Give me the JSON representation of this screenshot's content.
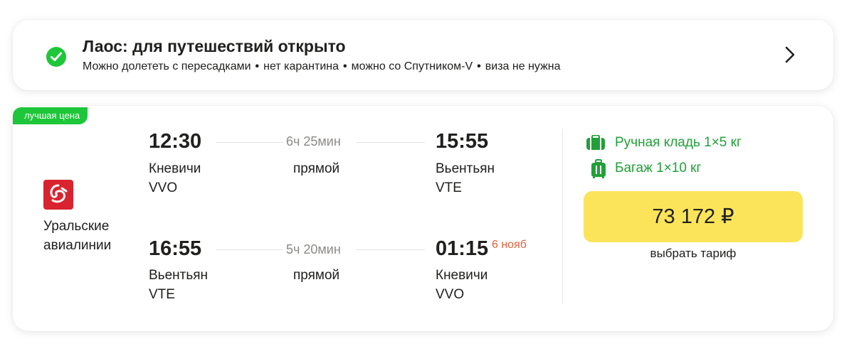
{
  "info": {
    "title": "Лаос: для путешествий открыто",
    "tags": [
      "Можно долететь с пересадками",
      "нет карантина",
      "можно со Спутником-V",
      "виза не нужна"
    ],
    "separator": "•"
  },
  "flight": {
    "badge": "лучшая цена",
    "airline": "Уральские авиалинии",
    "outbound": {
      "departure_time": "12:30",
      "departure_city": "Кневичи",
      "departure_code": "VVO",
      "duration": "6ч 25мин",
      "type": "прямой",
      "arrival_time": "15:55",
      "arrival_city": "Вьентьян",
      "arrival_code": "VTE"
    },
    "return": {
      "departure_time": "16:55",
      "departure_city": "Вьентьян",
      "departure_code": "VTE",
      "duration": "5ч 20мин",
      "type": "прямой",
      "arrival_time": "01:15",
      "arrival_date_note": "6 нояб",
      "arrival_city": "Кневичи",
      "arrival_code": "VVO"
    },
    "baggage": {
      "carry_on": "Ручная кладь 1×5 кг",
      "checked": "Багаж 1×10 кг"
    },
    "price": "73 172 ₽",
    "select_tariff": "выбрать тариф"
  },
  "colors": {
    "accent_green": "#1ec639",
    "baggage_green": "#21a038",
    "price_button": "#fce45a",
    "next_day": "#e5603b",
    "airline_red": "#d9232f"
  },
  "icons": [
    "check-icon",
    "chevron-right-icon",
    "airline-logo-icon",
    "carry-on-icon",
    "suitcase-icon"
  ]
}
